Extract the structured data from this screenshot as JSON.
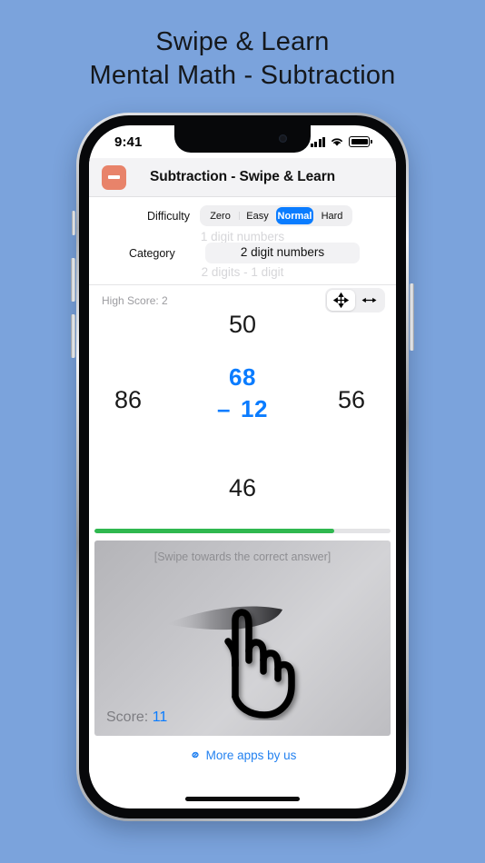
{
  "promo": {
    "line1": "Swipe & Learn",
    "line2": "Mental Math - Subtraction"
  },
  "status_bar": {
    "time": "9:41",
    "signal_icon": "cellular-signal-icon",
    "wifi_icon": "wifi-icon",
    "battery_icon": "battery-icon"
  },
  "navbar": {
    "app_icon": "minus-app-icon",
    "title": "Subtraction - Swipe & Learn"
  },
  "settings": {
    "difficulty_label": "Difficulty",
    "difficulty_options": [
      "Zero",
      "Easy",
      "Normal",
      "Hard"
    ],
    "difficulty_selected": "Normal",
    "category_label": "Category",
    "category_above": "1 digit numbers",
    "category_selected": "2 digit numbers",
    "category_below": "2 digits - 1 digit"
  },
  "game": {
    "high_score_label": "High Score: 2",
    "mode_four_way_icon": "four-way-arrows-icon",
    "mode_horizontal_icon": "horizontal-arrows-icon",
    "mode_selected": "four-way",
    "answer_top": "50",
    "answer_left": "86",
    "answer_right": "56",
    "answer_bottom": "46",
    "problem_operand1": "68",
    "problem_operator": "–",
    "problem_operand2": "12",
    "progress_percent": 81,
    "accent_blue": "#0a7cff",
    "progress_green": "#2fb84f"
  },
  "card": {
    "hint": "[Swipe towards the correct answer]",
    "score_label": "Score: ",
    "score_value": "11",
    "hand_icon": "swipe-hand-icon"
  },
  "footer": {
    "link_icon": "link-icon",
    "link_label": "More apps by us"
  }
}
